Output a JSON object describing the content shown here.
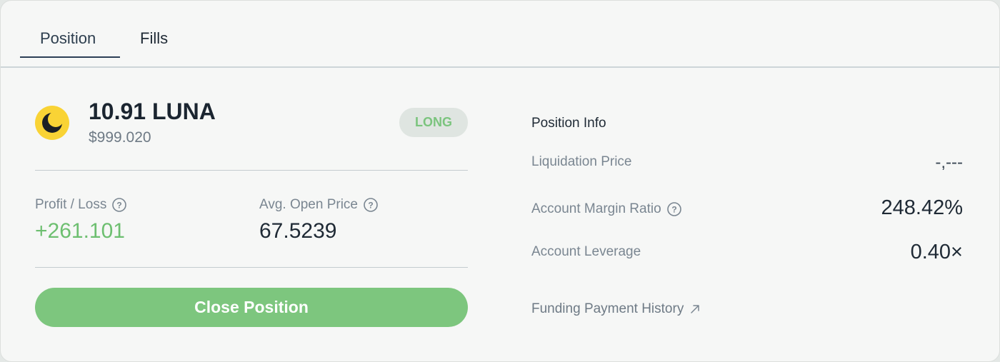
{
  "tabs": [
    {
      "label": "Position",
      "active": true
    },
    {
      "label": "Fills",
      "active": false
    }
  ],
  "position": {
    "coin_icon": "luna-coin-icon",
    "amount": "10.91 LUNA",
    "usd_value": "$999.020",
    "side": "LONG",
    "profit_loss_label": "Profit / Loss",
    "profit_loss_value": "+261.101",
    "avg_open_price_label": "Avg. Open Price",
    "avg_open_price_value": "67.5239",
    "close_button_label": "Close Position"
  },
  "info": {
    "title": "Position Info",
    "liquidation_price_label": "Liquidation Price",
    "liquidation_price_value": "-,---",
    "account_margin_ratio_label": "Account Margin Ratio",
    "account_margin_ratio_value": "248.42%",
    "account_leverage_label": "Account Leverage",
    "account_leverage_value": "0.40×",
    "funding_history_label": "Funding Payment History"
  },
  "colors": {
    "accent_green": "#7dc67e",
    "profit_green": "#6dbf70",
    "luna_yellow": "#f9d335",
    "text_dark": "#1f2a35",
    "text_muted": "#7a8691"
  }
}
